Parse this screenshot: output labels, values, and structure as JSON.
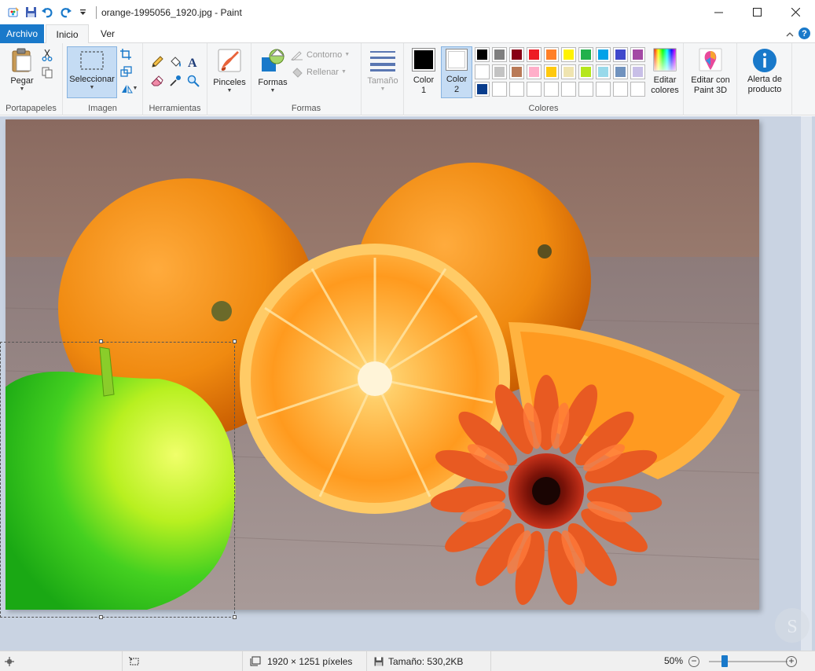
{
  "window": {
    "title": "orange-1995056_1920.jpg - Paint"
  },
  "tabs": [
    {
      "label": "Archivo"
    },
    {
      "label": "Inicio"
    },
    {
      "label": "Ver"
    }
  ],
  "ribbon": {
    "portapapeles": {
      "label": "Portapapeles",
      "paste_label": "Pegar"
    },
    "imagen": {
      "label": "Imagen",
      "select_label": "Seleccionar"
    },
    "herramientas": {
      "label": "Herramientas"
    },
    "pinceles": {
      "label": "Pinceles"
    },
    "formas": {
      "label": "Formas",
      "shapes_label": "Formas",
      "outline_label": "Contorno",
      "fill_label": "Rellenar"
    },
    "tamano": {
      "label": "Tamaño"
    },
    "colores": {
      "label": "Colores",
      "color1_label": "Color\n1",
      "color1_line1": "Color",
      "color1_line2": "1",
      "color2_line1": "Color",
      "color2_line2": "2",
      "color1": "#000000",
      "color2": "#ffffff",
      "palette_row1": [
        "#000000",
        "#7f7f7f",
        "#880015",
        "#ed1c24",
        "#ff7f27",
        "#fff200",
        "#22b14c",
        "#00a2e8",
        "#3f48cc",
        "#a349a4"
      ],
      "palette_row2": [
        "#ffffff",
        "#c3c3c3",
        "#b97a57",
        "#ffaec9",
        "#ffc90e",
        "#efe4b0",
        "#b5e61d",
        "#99d9ea",
        "#7092be",
        "#c8bfe7"
      ],
      "palette_row3": [
        "#0a3d8c",
        "#ffffff",
        "#ffffff",
        "#ffffff",
        "#ffffff",
        "#ffffff",
        "#ffffff",
        "#ffffff",
        "#ffffff",
        "#ffffff"
      ],
      "edit_line1": "Editar",
      "edit_line2": "colores"
    },
    "paint3d": {
      "line1": "Editar con",
      "line2": "Paint 3D"
    },
    "alerta": {
      "line1": "Alerta de",
      "line2": "producto"
    }
  },
  "statusbar": {
    "dimensions": "1920 × 1251 píxeles",
    "size": "Tamaño: 530,2KB",
    "zoom": "50%",
    "zoom_fraction": 0.2
  }
}
